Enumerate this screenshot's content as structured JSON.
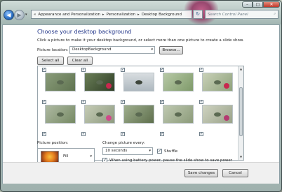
{
  "window": {
    "controls": [
      "–",
      "□",
      "✕"
    ]
  },
  "nav": {
    "back_glyph": "◀",
    "forward_glyph": "▶",
    "dropdown_glyph": "▾"
  },
  "address": {
    "prefix": "«",
    "crumbs": [
      "Appearance and Personalization",
      "Personalization",
      "Desktop Background"
    ],
    "sep": "▸",
    "refresh_glyph": "↻"
  },
  "search": {
    "placeholder": "Search Control Panel",
    "icon_glyph": "⌕"
  },
  "page": {
    "heading": "Choose your desktop background",
    "intro": "Click a picture to make it your desktop background, or select more than one picture to create a slide show."
  },
  "location": {
    "label": "Picture location:",
    "value": "DesktopBackground",
    "browse_label": "Browse..."
  },
  "selection": {
    "select_all_label": "Select all",
    "clear_all_label": "Clear all"
  },
  "gallery": {
    "check_glyph": "✓"
  },
  "position": {
    "label": "Picture position:",
    "value": "Fill"
  },
  "interval": {
    "label": "Change picture every:",
    "value": "10 seconds"
  },
  "shuffle": {
    "label": "Shuffle",
    "checked": true
  },
  "battery": {
    "label": "When using battery power, pause the slide show to save power",
    "checked": true
  },
  "footer": {
    "save_label": "Save changes",
    "cancel_label": "Cancel"
  },
  "colors": {
    "heading": "#1e3287",
    "window_frame": "#9fb1ae",
    "content_bg": "#ffffff"
  }
}
